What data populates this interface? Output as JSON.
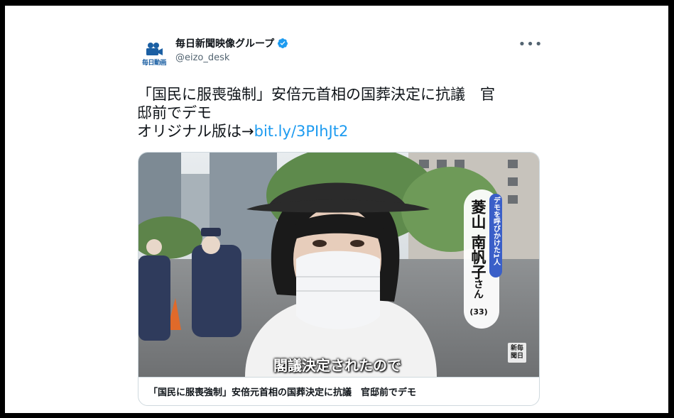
{
  "account": {
    "avatar_label": "毎日動画",
    "display_name": "毎日新聞映像グループ",
    "handle": "@eizo_desk",
    "verified": true
  },
  "more_label": "•••",
  "tweet": {
    "line1": "「国民に服喪強制」安倍元首相の国葬決定に抗議　官",
    "line2": "邸前でデモ",
    "line3_prefix": "オリジナル版は→",
    "link_text": "bit.ly/3PIhJt2"
  },
  "card": {
    "video_caption": "閣議決定されたので",
    "name_tag": "デモを呼びかけた1人",
    "person_name": "菱山 南帆子",
    "honorific": "さん",
    "age": "(33)",
    "logo_text": "新毎聞日",
    "title": "「国民に服喪強制」安倍元首相の国葬決定に抗議　官邸前でデモ"
  },
  "colors": {
    "accent": "#1d9bf0",
    "text": "#0f1419",
    "secondary": "#536471",
    "border": "#cfd9de",
    "tag_blue": "#3a5fc8"
  },
  "icons": [
    "camera-icon",
    "verified-badge-icon",
    "more-options-icon"
  ]
}
